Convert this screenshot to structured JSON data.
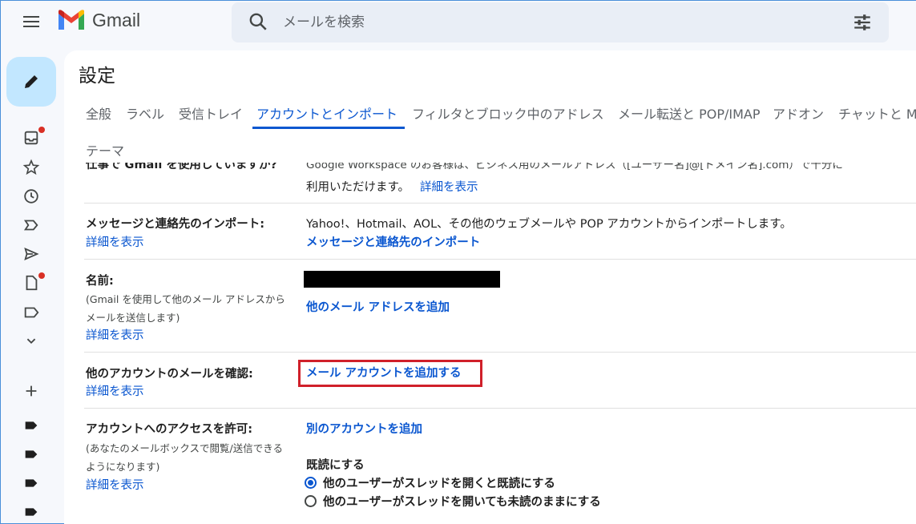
{
  "app": {
    "name": "Gmail"
  },
  "search": {
    "placeholder": "メールを検索"
  },
  "page": {
    "title": "設定"
  },
  "tabs": [
    {
      "label": "全般"
    },
    {
      "label": "ラベル"
    },
    {
      "label": "受信トレイ"
    },
    {
      "label": "アカウントとインポート"
    },
    {
      "label": "フィルタとブロック中のアドレス"
    },
    {
      "label": "メール転送と POP/IMAP"
    },
    {
      "label": "アドオン"
    },
    {
      "label": "チャットと M"
    },
    {
      "label": "テーマ"
    }
  ],
  "sections": {
    "work": {
      "label": "仕事で Gmail を使用していますか?",
      "value": "Google Workspace のお客様は、ビジネス用のメールアドレス（[ユーザー名]@[ドメイン名].com）で十分に",
      "value2": "利用いただけます。",
      "link": "詳細を表示"
    },
    "import": {
      "label": "メッセージと連絡先のインポート:",
      "link": "詳細を表示",
      "value": "Yahoo!、Hotmail、AOL、その他のウェブメールや POP アカウントからインポートします。",
      "action": "メッセージと連絡先のインポート"
    },
    "name": {
      "label": "名前:",
      "sub1": "(Gmail を使用して他のメール アドレスから",
      "sub2": "メールを送信します)",
      "link": "詳細を表示",
      "action": "他のメール アドレスを追加"
    },
    "check": {
      "label": "他のアカウントのメールを確認:",
      "link": "詳細を表示",
      "action": "メール アカウントを追加する"
    },
    "grant": {
      "label": "アカウントへのアクセスを許可:",
      "sub1": "(あなたのメールボックスで閲覧/送信できる",
      "sub2": "ようになります)",
      "link": "詳細を表示",
      "action": "別のアカウントを追加",
      "read_heading": "既読にする",
      "options": [
        {
          "label": "他のユーザーがスレッドを開くと既読にする",
          "selected": true
        },
        {
          "label": "他のユーザーがスレッドを開いても未読のままにする",
          "selected": false
        }
      ]
    }
  },
  "colors": {
    "accent": "#0b57d0",
    "compose_bg": "#c2e7ff",
    "highlight": "#d0202a",
    "notify": "#d93025"
  }
}
